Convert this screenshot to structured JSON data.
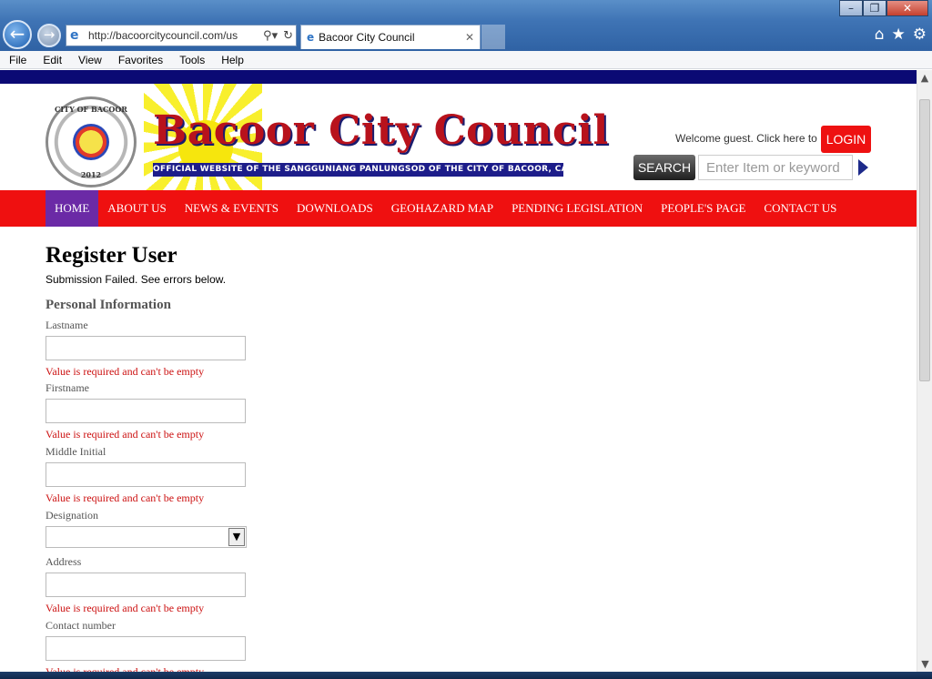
{
  "browser": {
    "url": "http://bacoorcitycouncil.com/us",
    "tab_title": "Bacoor City Council",
    "menu": [
      "File",
      "Edit",
      "View",
      "Favorites",
      "Tools",
      "Help"
    ]
  },
  "header": {
    "seal_text_top": "CITY OF BACOOR",
    "seal_text_bottom": "2012",
    "site_title": "Bacoor City Council",
    "site_subtitle": "OFFICIAL WEBSITE OF THE SANGGUNIANG PANLUNGSOD OF THE CITY OF BACOOR, CAVITE",
    "welcome_text": "Welcome guest. Click here to",
    "login_label": "LOGIN",
    "search_label": "SEARCH",
    "search_placeholder": "Enter Item or keyword"
  },
  "nav": {
    "items": [
      "HOME",
      "ABOUT US",
      "NEWS & EVENTS",
      "DOWNLOADS",
      "GEOHAZARD MAP",
      "PENDING LEGISLATION",
      "PEOPLE'S PAGE",
      "CONTACT US"
    ],
    "active": "HOME"
  },
  "form": {
    "title": "Register User",
    "status": "Submission Failed. See errors below.",
    "section": "Personal Information",
    "error_text": "Value is required and can't be empty",
    "fields": {
      "lastname": "Lastname",
      "firstname": "Firstname",
      "middle_initial": "Middle Initial",
      "designation": "Designation",
      "address": "Address",
      "contact_number": "Contact number"
    }
  },
  "colors": {
    "nav_bg": "#ef1010",
    "nav_active": "#6b2aa6",
    "top_stripe": "#0b0a74",
    "error": "#cc1111"
  }
}
